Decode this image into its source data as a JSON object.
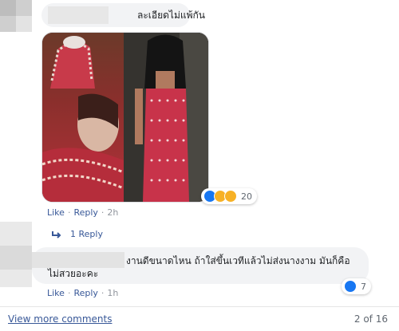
{
  "comment_top": {
    "text": "ละเอียดไม่แพ้กัน",
    "actions": {
      "like": "Like",
      "reply": "Reply",
      "time": "2h"
    },
    "reactions": {
      "icons": [
        "like-icon",
        "haha-icon",
        "wow-icon"
      ],
      "count": "20"
    },
    "replies": {
      "label": "1 Reply"
    }
  },
  "comment_mid": {
    "line1": "งานดีขนาดไหน ถ้าใส่ขึ้นเวทีแล้วไม่ส่งนางงาม มันก็คือ",
    "line2": "ไม่สวยอะคะ",
    "actions": {
      "like": "Like",
      "reply": "Reply",
      "time": "1h"
    },
    "reactions": {
      "icons": [
        "like-icon"
      ],
      "count": "7"
    }
  },
  "footer": {
    "view_more": "View more comments",
    "page_count": "2 of 16"
  },
  "colors": {
    "link": "#385898",
    "bubble": "#f2f3f5",
    "like": "#1877f2"
  }
}
